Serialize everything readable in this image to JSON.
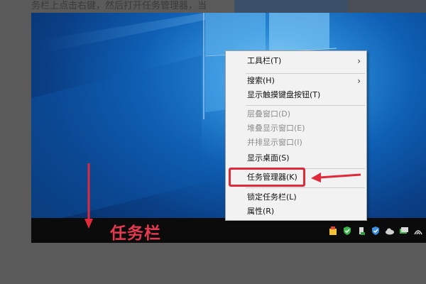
{
  "article": {
    "caption": "务栏上点击右键，然后打开任务管理器，当"
  },
  "annotation": {
    "taskbar_label": "任务栏",
    "accent_color": "#e02a3a"
  },
  "context_menu": {
    "items": [
      {
        "label": "工具栏(T)",
        "has_submenu": true,
        "enabled": true
      },
      {
        "label": "搜索(H)",
        "has_submenu": true,
        "enabled": true
      },
      {
        "label": "显示触摸键盘按钮(T)",
        "has_submenu": false,
        "enabled": true
      },
      {
        "label": "层叠窗口(D)",
        "has_submenu": false,
        "enabled": false
      },
      {
        "label": "堆叠显示窗口(E)",
        "has_submenu": false,
        "enabled": false
      },
      {
        "label": "并排显示窗口(I)",
        "has_submenu": false,
        "enabled": false
      },
      {
        "label": "显示桌面(S)",
        "has_submenu": false,
        "enabled": true
      },
      {
        "label": "任务管理器(K)",
        "has_submenu": false,
        "enabled": true,
        "highlighted": true
      },
      {
        "label": "锁定任务栏(L)",
        "has_submenu": false,
        "enabled": true
      },
      {
        "label": "属性(R)",
        "has_submenu": false,
        "enabled": true
      }
    ]
  },
  "tray": {
    "icons": [
      "shield-bag-icon",
      "shield-check-icon",
      "usb-icon",
      "security-shield-icon",
      "cloud-icon",
      "network-icon",
      "wifi-icon"
    ]
  }
}
